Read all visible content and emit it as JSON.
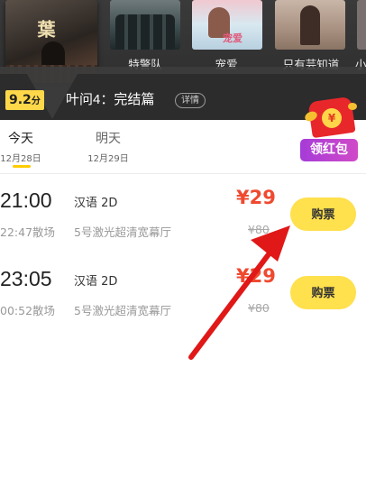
{
  "header": {
    "posters": [
      {
        "title": "特警队"
      },
      {
        "title": "宠爱"
      },
      {
        "title": "只有芸知道"
      },
      {
        "title": "小"
      }
    ],
    "main_poster_art": "葉",
    "rating_value": "9.2",
    "rating_unit": "分",
    "movie_title": "叶问4：完结篇",
    "detail_label": "详情"
  },
  "red_packet": {
    "coin_symbol": "¥",
    "label": "领红包"
  },
  "date_tabs": [
    {
      "day": "今天",
      "date": "12月28日",
      "selected": true
    },
    {
      "day": "明天",
      "date": "12月29日",
      "selected": false
    }
  ],
  "showtimes": [
    {
      "start": "21:00",
      "end": "22:47散场",
      "language": "汉语 2D",
      "hall": "5号激光超清宽幕厅",
      "price": "¥29",
      "original_price": "¥80",
      "buy_label": "购票"
    },
    {
      "start": "23:05",
      "end": "00:52散场",
      "language": "汉语 2D",
      "hall": "5号激光超清宽幕厅",
      "price": "¥29",
      "original_price": "¥80",
      "buy_label": "购票"
    }
  ],
  "colors": {
    "header_bg": "#2e2e2e",
    "rating_bg": "#ffd84a",
    "price": "#ef4a30",
    "buy_button": "#ffe04d",
    "tab_underline": "#ffcc00",
    "red_packet_label": "#b63fd4",
    "annotation_arrow": "#e01818"
  }
}
